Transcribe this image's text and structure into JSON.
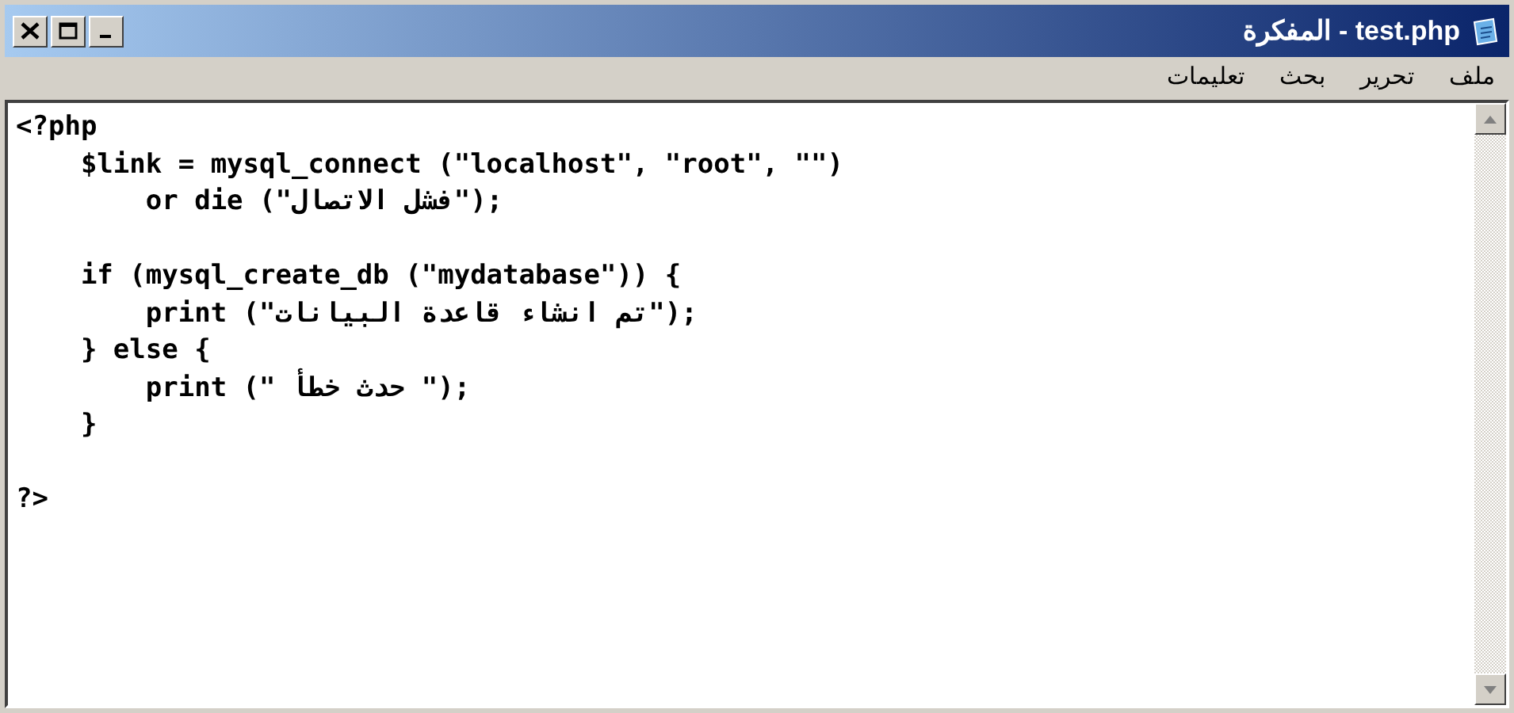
{
  "window": {
    "title": "test.php - المفكرة"
  },
  "menu": [
    {
      "label": "ملف"
    },
    {
      "label": "تحرير"
    },
    {
      "label": "بحث"
    },
    {
      "label": "تعليمات"
    }
  ],
  "editor": {
    "lines": [
      {
        "kind": "code",
        "text": "<?php"
      },
      {
        "kind": "code",
        "text": "    $link = mysql_connect (\"localhost\", \"root\", \"\")"
      },
      {
        "kind": "code",
        "text": "        or die (\"فشل الاتصال\");"
      },
      {
        "kind": "blank"
      },
      {
        "kind": "code",
        "text": "    if (mysql_create_db (\"mydatabase\")) {"
      },
      {
        "kind": "code",
        "text": "        print (\"تم انشاء قاعدة البيانات\");"
      },
      {
        "kind": "code",
        "text": "    } else {"
      },
      {
        "kind": "code",
        "text": "        print (\" حدث خطأ \");"
      },
      {
        "kind": "code",
        "text": "    }"
      },
      {
        "kind": "blank"
      },
      {
        "kind": "code",
        "text": "?>"
      }
    ]
  }
}
